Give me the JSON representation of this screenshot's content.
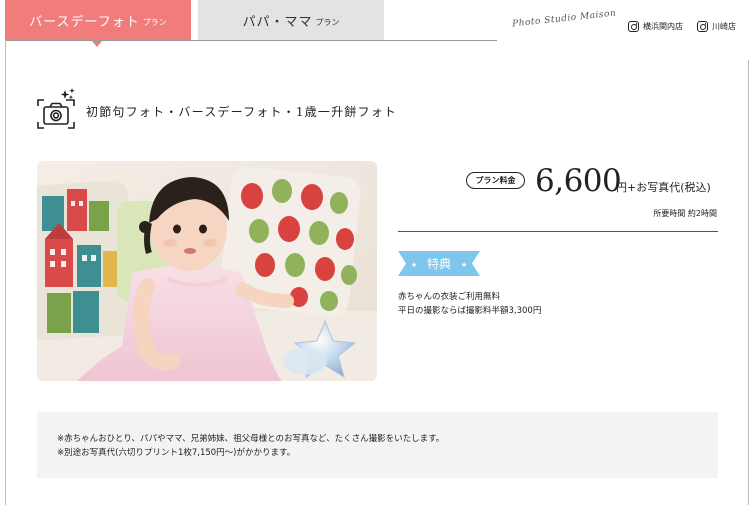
{
  "tabs": [
    {
      "label": "バースデーフォト",
      "sub": "プラン",
      "active": true
    },
    {
      "label": "パパ・ママ",
      "sub": "プラン",
      "active": false
    }
  ],
  "brand": "Photo Studio Maison",
  "stores": [
    "横浜関内店",
    "川崎店"
  ],
  "heading": "初節句フォト・バースデーフォト・1歳一升餅フォト",
  "price": {
    "badge": "プラン料金",
    "amount": "6,600",
    "suffix": "円+お写真代(税込)",
    "duration": "所要時間 約2時間"
  },
  "benefit": {
    "label": "特典",
    "items": [
      "赤ちゃんの衣装ご利用無料",
      "平日の撮影ならば撮影料半額3,300円"
    ]
  },
  "notes": [
    "※赤ちゃんおひとり、パパやママ、兄弟姉妹、祖父母様とのお写真など、たくさん撮影をいたします。",
    "※別途お写真代(六切りプリント1枚7,150円〜)がかかります。"
  ],
  "colors": {
    "accent": "#f07c7c",
    "ribbon": "#7fc6ee",
    "tab_inactive": "#e3e3e3",
    "notes_bg": "#f3f3f3"
  },
  "icons": [
    "instagram-icon",
    "camera-icon"
  ]
}
